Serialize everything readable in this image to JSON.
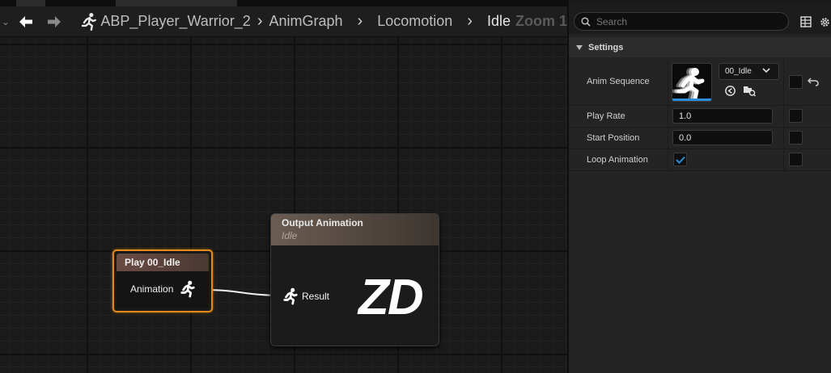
{
  "breadcrumb": {
    "items": [
      "ABP_Player_Warrior_2",
      "AnimGraph",
      "Locomotion",
      "Idle"
    ],
    "zoom_text": "Zoom 1"
  },
  "graph": {
    "play_node": {
      "title": "Play 00_Idle",
      "pin_label": "Animation"
    },
    "output_node": {
      "title": "Output Animation",
      "subtitle": "Idle",
      "pin_label": "Result",
      "logo_text": "ZD"
    }
  },
  "details": {
    "search": {
      "placeholder": "Search"
    },
    "section_title": "Settings",
    "rows": {
      "anim_sequence": {
        "label": "Anim Sequence",
        "asset_name": "00_Idle"
      },
      "play_rate": {
        "label": "Play Rate",
        "value": "1.0"
      },
      "start_position": {
        "label": "Start Position",
        "value": "0.0"
      },
      "loop_animation": {
        "label": "Loop Animation",
        "checked": true
      }
    }
  },
  "colors": {
    "selection_outline": "#e08a1a",
    "accent_blue": "#2a8fd6"
  }
}
